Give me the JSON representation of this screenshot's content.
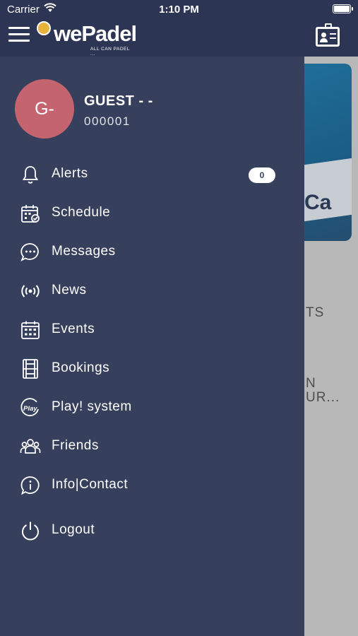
{
  "status_bar": {
    "carrier": "Carrier",
    "time": "1:10 PM"
  },
  "header": {
    "logo_text": "wePadel",
    "logo_tagline": "ALL CAN PADEL ...",
    "menu_icon": "hamburger-menu-icon",
    "profile_icon": "contact-card-icon"
  },
  "background_content": {
    "image_text": "Ca",
    "text_line_1": "TS",
    "text_line_2": "N",
    "text_line_3": "UR..."
  },
  "drawer": {
    "avatar_initials": "G-",
    "user_name": "GUEST - -",
    "user_id": "000001",
    "items": [
      {
        "label": "Alerts",
        "icon": "bell-icon",
        "badge": "0"
      },
      {
        "label": "Schedule",
        "icon": "calendar-check-icon"
      },
      {
        "label": "Messages",
        "icon": "chat-bubble-icon"
      },
      {
        "label": "News",
        "icon": "broadcast-icon"
      },
      {
        "label": "Events",
        "icon": "calendar-grid-icon"
      },
      {
        "label": "Bookings",
        "icon": "court-icon"
      },
      {
        "label": "Play! system",
        "icon": "play-logo-icon"
      },
      {
        "label": "Friends",
        "icon": "friends-icon"
      },
      {
        "label": "Info|Contact",
        "icon": "info-icon"
      },
      {
        "label": "Logout",
        "icon": "power-icon"
      }
    ]
  },
  "colors": {
    "header_bg": "#2c3553",
    "drawer_bg": "#363f5c",
    "avatar_bg": "#c4646e",
    "overlay_bg": "#b8b8b8",
    "text": "#ffffff"
  }
}
